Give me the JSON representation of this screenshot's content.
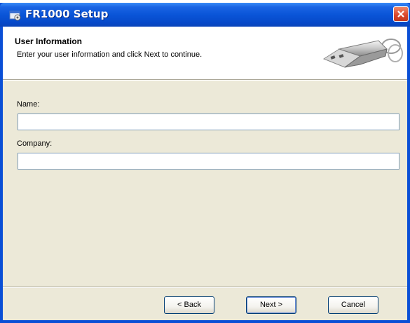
{
  "window": {
    "title": "FR1000 Setup",
    "icon": "setup-icon",
    "close_icon": "close-icon"
  },
  "header": {
    "title": "User Information",
    "subtitle": "Enter your user information and click Next to continue.",
    "graphic": "usb-drive-image"
  },
  "form": {
    "name_label": "Name:",
    "name_value": "",
    "company_label": "Company:",
    "company_value": ""
  },
  "buttons": {
    "back": "< Back",
    "next": "Next >",
    "cancel": "Cancel"
  },
  "colors": {
    "titlebar": "#0a55d8",
    "dialog_bg": "#ece9d8",
    "close_button": "#d9452a"
  }
}
